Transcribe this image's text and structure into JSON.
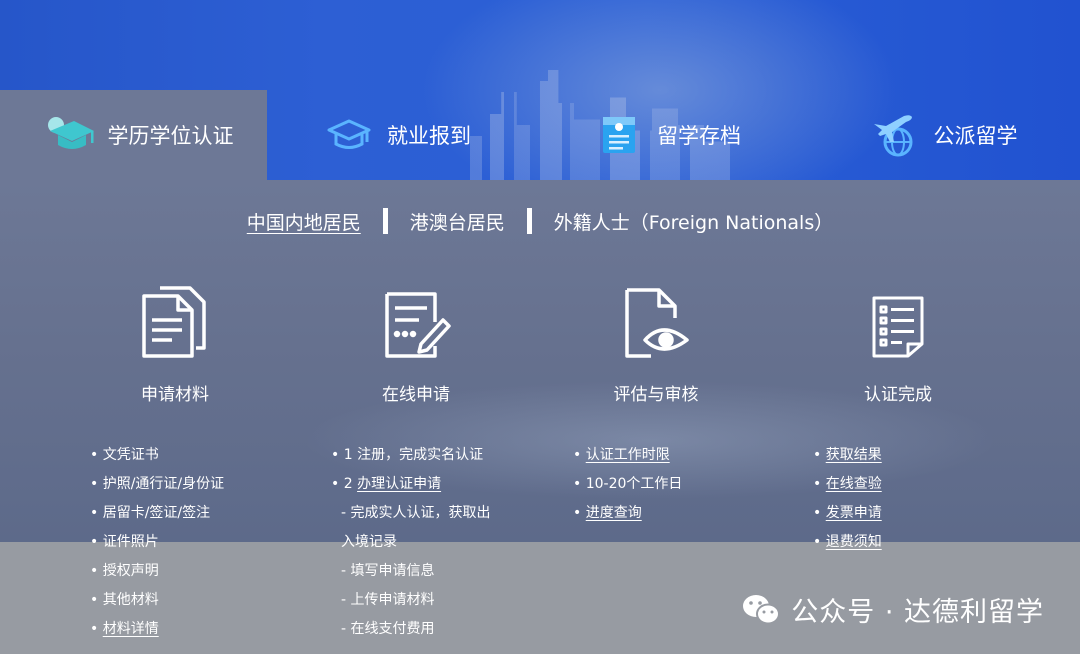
{
  "tabs": [
    {
      "label": "学历学位认证",
      "icon": "graduation-cap-icon",
      "active": true
    },
    {
      "label": "就业报到",
      "icon": "mortarboard-icon",
      "active": false
    },
    {
      "label": "留学存档",
      "icon": "archive-folder-icon",
      "active": false
    },
    {
      "label": "公派留学",
      "icon": "airplane-globe-icon",
      "active": false
    }
  ],
  "regions": {
    "mainland": "中国内地居民",
    "hmt": "港澳台居民",
    "foreign": "外籍人士（Foreign Nationals）"
  },
  "steps": [
    {
      "title": "申请材料",
      "icon": "documents-icon"
    },
    {
      "title": "在线申请",
      "icon": "edit-form-icon"
    },
    {
      "title": "评估与审核",
      "icon": "document-eye-icon"
    },
    {
      "title": "认证完成",
      "icon": "checklist-icon"
    }
  ],
  "materials": [
    "• 文凭证书",
    "• 护照/通行证/身份证",
    "• 居留卡/签证/签注",
    "• 证件照片",
    "• 授权声明",
    "• 其他材料",
    "• 材料详情"
  ],
  "online": {
    "i1": "• 1 注册，完成实名认证",
    "i2_prefix": "• 2 ",
    "i2_link": "办理认证申请",
    "s1a": "- 完成实人认证，获取出",
    "s1b": "入境记录",
    "s2": "- 填写申请信息",
    "s3": "- 上传申请材料",
    "s4": "- 在线支付费用"
  },
  "review": {
    "bullet": "• ",
    "link1": "认证工作时限",
    "item2": "• 10-20个工作日",
    "link3": "进度查询"
  },
  "done": {
    "bullet": "• ",
    "link1": "获取结果",
    "link2": "在线查验",
    "link3": "发票申请",
    "link4": "退费须知"
  },
  "materials_last_link": "材料详情",
  "watermark": "公众号 · 达德利留学"
}
